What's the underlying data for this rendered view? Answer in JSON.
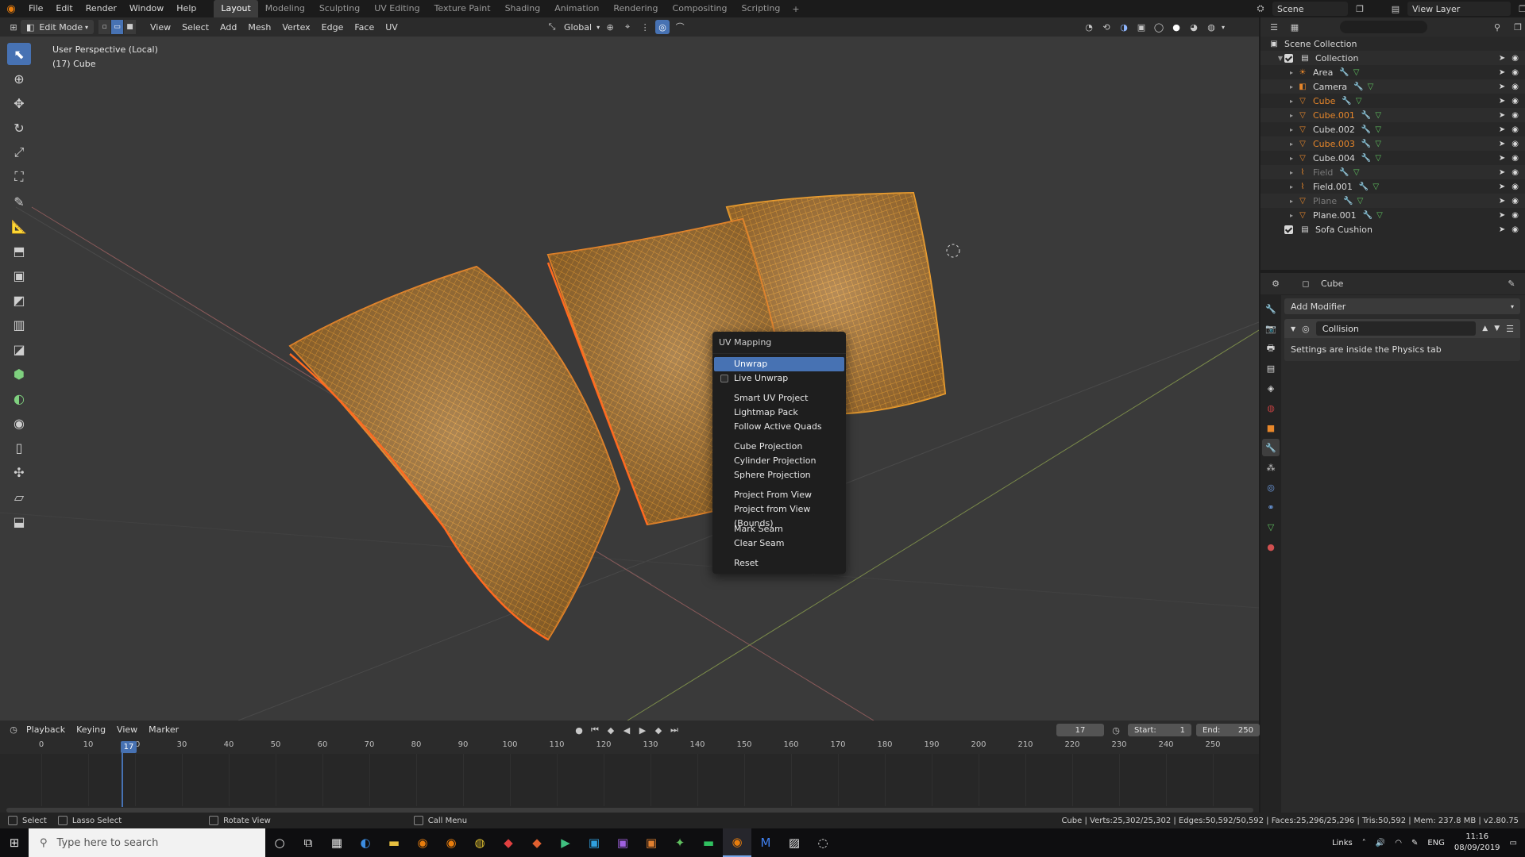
{
  "topbar": {
    "menus": [
      "File",
      "Edit",
      "Render",
      "Window",
      "Help"
    ],
    "workspaces": [
      "Layout",
      "Modeling",
      "Sculpting",
      "UV Editing",
      "Texture Paint",
      "Shading",
      "Animation",
      "Rendering",
      "Compositing",
      "Scripting"
    ],
    "active_workspace": "Layout",
    "add_tab": "+",
    "scene_label": "Scene",
    "view_layer_label": "View Layer"
  },
  "viewport_header": {
    "mode": "Edit Mode",
    "menus": [
      "View",
      "Select",
      "Add",
      "Mesh",
      "Vertex",
      "Edge",
      "Face",
      "UV"
    ],
    "orientation": "Global"
  },
  "viewport": {
    "perspective_label": "User Perspective (Local)",
    "object_label": "(17) Cube"
  },
  "uv_menu": {
    "title": "UV Mapping",
    "items": [
      {
        "label": "Unwrap",
        "selected": true
      },
      {
        "label": "Live Unwrap",
        "checkbox": true
      },
      {
        "gap": true
      },
      {
        "label": "Smart UV Project"
      },
      {
        "label": "Lightmap Pack"
      },
      {
        "label": "Follow Active Quads"
      },
      {
        "gap": true
      },
      {
        "label": "Cube Projection"
      },
      {
        "label": "Cylinder Projection"
      },
      {
        "label": "Sphere Projection"
      },
      {
        "gap": true
      },
      {
        "label": "Project From View"
      },
      {
        "label": "Project from View (Bounds)"
      },
      {
        "gap": true
      },
      {
        "label": "Mark Seam"
      },
      {
        "label": "Clear Seam"
      },
      {
        "gap": true
      },
      {
        "label": "Reset"
      }
    ]
  },
  "timeline": {
    "menus": [
      "Playback",
      "Keying",
      "View",
      "Marker"
    ],
    "current_frame": "17",
    "start_label": "Start:",
    "start_value": "1",
    "end_label": "End:",
    "end_value": "250",
    "ticks": [
      "0",
      "10",
      "20",
      "30",
      "40",
      "50",
      "60",
      "70",
      "80",
      "90",
      "100",
      "110",
      "120",
      "130",
      "140",
      "150",
      "160",
      "170",
      "180",
      "190",
      "200",
      "210",
      "220",
      "230",
      "240",
      "250"
    ]
  },
  "statusbar": {
    "select": "Select",
    "lasso": "Lasso Select",
    "rotate": "Rotate View",
    "call_menu": "Call Menu",
    "stats": "Cube | Verts:25,302/25,302 | Edges:50,592/50,592 | Faces:25,296/25,296 | Tris:50,592 | Mem: 237.8 MB | v2.80.75"
  },
  "outliner": {
    "root": "Scene Collection",
    "collection": "Collection",
    "items": [
      {
        "label": "Area",
        "icon": "light-icon",
        "color": "#d8d8d8"
      },
      {
        "label": "Camera",
        "icon": "camera-icon",
        "color": "#d8d8d8"
      },
      {
        "label": "Cube",
        "icon": "mesh-icon",
        "color": "#e8872a"
      },
      {
        "label": "Cube.001",
        "icon": "mesh-icon",
        "color": "#e8872a"
      },
      {
        "label": "Cube.002",
        "icon": "mesh-icon",
        "color": "#d8d8d8"
      },
      {
        "label": "Cube.003",
        "icon": "mesh-icon",
        "color": "#e8872a"
      },
      {
        "label": "Cube.004",
        "icon": "mesh-icon",
        "color": "#d8d8d8"
      },
      {
        "label": "Field",
        "icon": "field-icon",
        "color": "#7a7a7a"
      },
      {
        "label": "Field.001",
        "icon": "field-icon",
        "color": "#d8d8d8"
      },
      {
        "label": "Plane",
        "icon": "mesh-icon",
        "color": "#7a7a7a"
      },
      {
        "label": "Plane.001",
        "icon": "mesh-icon",
        "color": "#d8d8d8"
      }
    ],
    "sofa": "Sofa Cushion"
  },
  "properties": {
    "object_name": "Cube",
    "add_modifier": "Add Modifier",
    "modifier_name": "Collision",
    "modifier_note": "Settings are inside the Physics tab"
  },
  "taskbar": {
    "search_placeholder": "Type here to search",
    "links": "Links",
    "lang": "ENG",
    "time": "11:16",
    "date": "08/09/2019"
  },
  "colors": {
    "accent": "#4772b3",
    "selection_orange": "#e8872a",
    "mesh_wire": "#f0a030"
  }
}
